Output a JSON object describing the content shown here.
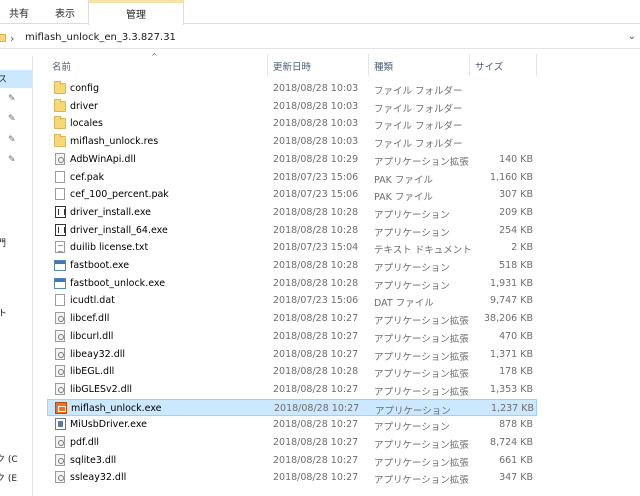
{
  "ribbon": {
    "tabs": [
      "共有",
      "表示"
    ],
    "context_tab": "管理"
  },
  "address": {
    "path": "miflash_unlock_en_3.3.827.31"
  },
  "nav": {
    "items": [
      "ス",
      "門",
      "ト",
      "ク (C",
      "ク (E"
    ]
  },
  "columns": {
    "name": "名前",
    "date": "更新日時",
    "type": "種類",
    "size": "サイズ"
  },
  "files": [
    {
      "name": "config",
      "date": "2018/08/28 10:03",
      "type": "ファイル フォルダー",
      "size": "",
      "icon": "folder-icon"
    },
    {
      "name": "driver",
      "date": "2018/08/28 10:03",
      "type": "ファイル フォルダー",
      "size": "",
      "icon": "folder-icon"
    },
    {
      "name": "locales",
      "date": "2018/08/28 10:03",
      "type": "ファイル フォルダー",
      "size": "",
      "icon": "folder-icon"
    },
    {
      "name": "miflash_unlock.res",
      "date": "2018/08/28 10:03",
      "type": "ファイル フォルダー",
      "size": "",
      "icon": "folder-icon"
    },
    {
      "name": "AdbWinApi.dll",
      "date": "2018/08/28 10:29",
      "type": "アプリケーション拡張",
      "size": "140 KB",
      "icon": "dll-icon"
    },
    {
      "name": "cef.pak",
      "date": "2018/07/23 15:06",
      "type": "PAK ファイル",
      "size": "1,160 KB",
      "icon": "file-icon"
    },
    {
      "name": "cef_100_percent.pak",
      "date": "2018/07/23 15:06",
      "type": "PAK ファイル",
      "size": "307 KB",
      "icon": "file-icon"
    },
    {
      "name": "driver_install.exe",
      "date": "2018/08/28 10:28",
      "type": "アプリケーション",
      "size": "209 KB",
      "icon": "exe-bin-icon"
    },
    {
      "name": "driver_install_64.exe",
      "date": "2018/08/28 10:28",
      "type": "アプリケーション",
      "size": "254 KB",
      "icon": "exe-bin-icon"
    },
    {
      "name": "duilib license.txt",
      "date": "2018/07/23 15:04",
      "type": "テキスト ドキュメント",
      "size": "2 KB",
      "icon": "text-file-icon"
    },
    {
      "name": "fastboot.exe",
      "date": "2018/08/28 10:28",
      "type": "アプリケーション",
      "size": "518 KB",
      "icon": "app-icon"
    },
    {
      "name": "fastboot_unlock.exe",
      "date": "2018/08/28 10:28",
      "type": "アプリケーション",
      "size": "1,931 KB",
      "icon": "app-icon"
    },
    {
      "name": "icudtl.dat",
      "date": "2018/07/23 15:06",
      "type": "DAT ファイル",
      "size": "9,747 KB",
      "icon": "file-icon"
    },
    {
      "name": "libcef.dll",
      "date": "2018/08/28 10:27",
      "type": "アプリケーション拡張",
      "size": "38,206 KB",
      "icon": "dll-icon"
    },
    {
      "name": "libcurl.dll",
      "date": "2018/08/28 10:27",
      "type": "アプリケーション拡張",
      "size": "470 KB",
      "icon": "dll-icon"
    },
    {
      "name": "libeay32.dll",
      "date": "2018/08/28 10:27",
      "type": "アプリケーション拡張",
      "size": "1,371 KB",
      "icon": "dll-icon"
    },
    {
      "name": "libEGL.dll",
      "date": "2018/08/28 10:28",
      "type": "アプリケーション拡張",
      "size": "178 KB",
      "icon": "dll-icon"
    },
    {
      "name": "libGLESv2.dll",
      "date": "2018/08/28 10:27",
      "type": "アプリケーション拡張",
      "size": "1,353 KB",
      "icon": "dll-icon"
    },
    {
      "name": "miflash_unlock.exe",
      "date": "2018/08/28 10:27",
      "type": "アプリケーション",
      "size": "1,237 KB",
      "icon": "mi-app-icon",
      "selected": true
    },
    {
      "name": "MiUsbDriver.exe",
      "date": "2018/08/28 10:27",
      "type": "アプリケーション",
      "size": "878 KB",
      "icon": "usb-driver-icon"
    },
    {
      "name": "pdf.dll",
      "date": "2018/08/28 10:27",
      "type": "アプリケーション拡張",
      "size": "8,724 KB",
      "icon": "dll-icon"
    },
    {
      "name": "sqlite3.dll",
      "date": "2018/08/28 10:27",
      "type": "アプリケーション拡張",
      "size": "661 KB",
      "icon": "dll-icon"
    },
    {
      "name": "ssleay32.dll",
      "date": "2018/08/28 10:27",
      "type": "アプリケーション拡張",
      "size": "347 KB",
      "icon": "dll-icon"
    }
  ]
}
